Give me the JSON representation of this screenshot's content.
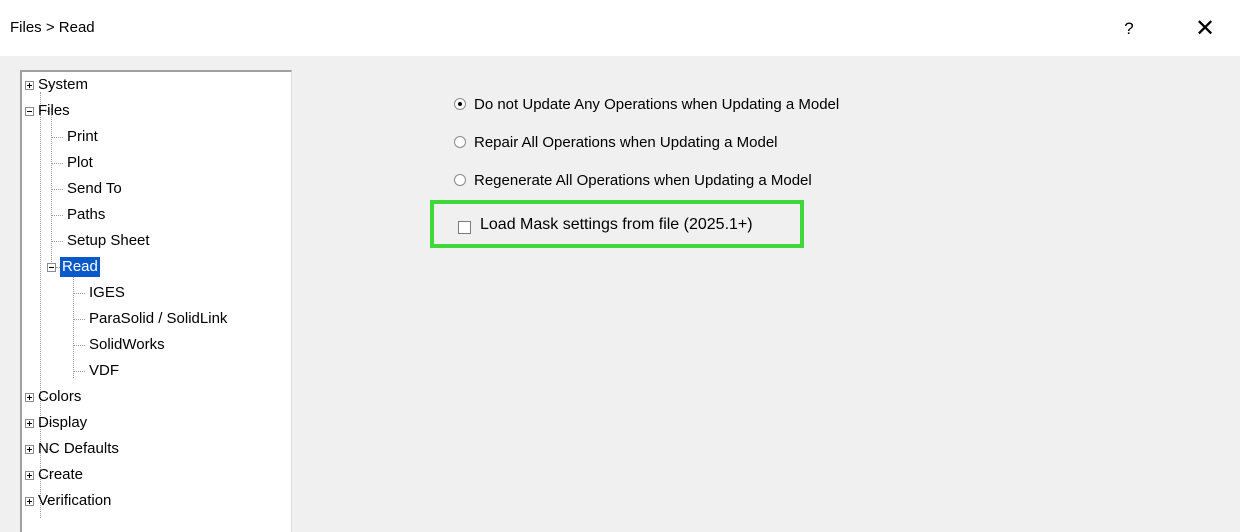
{
  "window": {
    "title": "Files > Read",
    "help_label": "?",
    "close_label": "✕"
  },
  "tree": {
    "items": [
      {
        "label": "System",
        "expander": "plus"
      },
      {
        "label": "Files",
        "expander": "minus"
      },
      {
        "label": "Print"
      },
      {
        "label": "Plot"
      },
      {
        "label": "Send To"
      },
      {
        "label": "Paths"
      },
      {
        "label": "Setup Sheet"
      },
      {
        "label": "Read",
        "expander": "minus",
        "selected": true
      },
      {
        "label": "IGES"
      },
      {
        "label": "ParaSolid / SolidLink"
      },
      {
        "label": "SolidWorks"
      },
      {
        "label": "VDF"
      },
      {
        "label": "Colors",
        "expander": "plus"
      },
      {
        "label": "Display",
        "expander": "plus"
      },
      {
        "label": "NC Defaults",
        "expander": "plus"
      },
      {
        "label": "Create",
        "expander": "plus"
      },
      {
        "label": "Verification",
        "expander": "plus"
      }
    ]
  },
  "options": {
    "radio1": "Do not Update Any Operations when Updating a Model",
    "radio2": "Repair All Operations when Updating a Model",
    "radio3": "Regenerate All Operations when Updating a Model",
    "selected_radio": "radio1",
    "checkbox_label": "Load Mask settings from file (2025.1+)",
    "checkbox_checked": false
  },
  "colors": {
    "highlight": "#3fd83a",
    "selection": "#0a59c9"
  }
}
